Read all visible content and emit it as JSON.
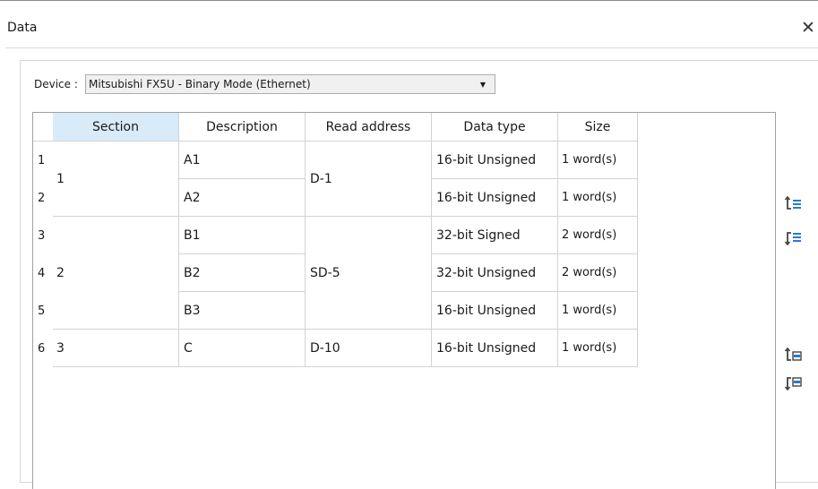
{
  "window": {
    "title": "Data"
  },
  "device": {
    "label": "Device :",
    "value": "Mitsubishi FX5U - Binary Mode (Ethernet)"
  },
  "table": {
    "headers": [
      "Section",
      "Description",
      "Read address",
      "Data type",
      "Size"
    ],
    "row_numbers": [
      "1",
      "2",
      "3",
      "4",
      "5",
      "6"
    ],
    "sections": [
      "1",
      "2",
      "3"
    ],
    "descriptions": [
      "A1",
      "A2",
      "B1",
      "B2",
      "B3",
      "C"
    ],
    "read_addresses": [
      "D-1",
      "SD-5",
      "D-10"
    ],
    "data_types": [
      "16-bit Unsigned",
      "16-bit Unsigned",
      "32-bit Signed",
      "32-bit Unsigned",
      "16-bit Unsigned",
      "16-bit Unsigned"
    ],
    "sizes": [
      "1 word(s)",
      "1 word(s)",
      "2 word(s)",
      "2 word(s)",
      "1 word(s)",
      "1 word(s)"
    ]
  },
  "side_buttons": [
    {
      "icon": "insert-row-above-icon"
    },
    {
      "icon": "insert-row-below-icon"
    },
    {
      "icon": "insert-section-above-icon"
    },
    {
      "icon": "insert-section-below-icon"
    }
  ],
  "colors": {
    "selected_header": "#d9ebf9",
    "icon_blue": "#2a7ad2",
    "icon_dark": "#444444"
  }
}
